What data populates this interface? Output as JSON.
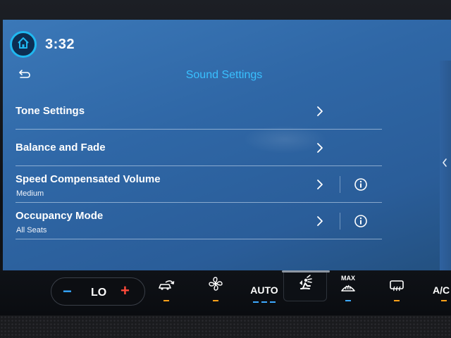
{
  "status_bar": {
    "time": "3:32"
  },
  "header": {
    "title": "Sound Settings"
  },
  "settings": [
    {
      "label": "Tone Settings",
      "value": "",
      "has_info": false
    },
    {
      "label": "Balance and Fade",
      "value": "",
      "has_info": false
    },
    {
      "label": "Speed Compensated Volume",
      "value": "Medium",
      "has_info": true
    },
    {
      "label": "Occupancy Mode",
      "value": "All Seats",
      "has_info": true
    }
  ],
  "climate": {
    "temperature": "LO",
    "minus": "−",
    "plus": "+",
    "auto_label": "AUTO",
    "max_label": "MAX",
    "ac_label": "A/C"
  },
  "colors": {
    "accent": "#39c0ff",
    "home_ring": "#1fb8f0",
    "temp_down": "#35a7ff",
    "temp_up": "#ff4a3a",
    "indicator_orange": "#ffa21a",
    "indicator_blue": "#3da9ff"
  },
  "icons": {
    "home": "home-icon",
    "back": "back-arrow-icon",
    "chevron": "chevron-right-icon",
    "info": "info-icon",
    "recirculation": "recirculation-icon",
    "fan": "fan-icon",
    "seat_airflow": "seat-airflow-icon",
    "max_defrost": "max-defrost-icon",
    "rear_defrost": "rear-defrost-icon"
  }
}
